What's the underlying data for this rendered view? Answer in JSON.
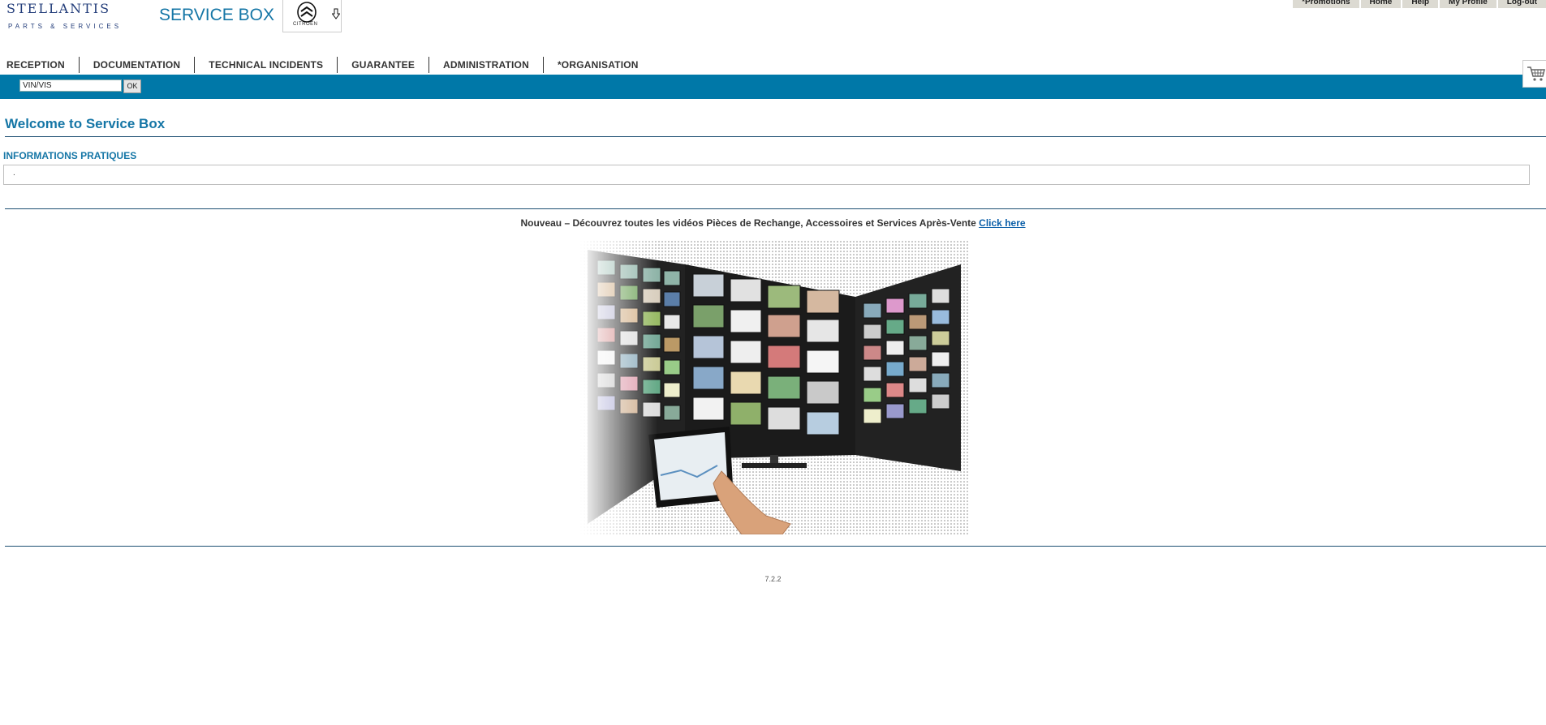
{
  "header": {
    "logo_main": "STELLANTIS",
    "logo_sub": "PARTS & SERVICES",
    "app_title": "SERVICE BOX",
    "brand_name": "CITROËN",
    "brand_color": "#1576a6"
  },
  "top_links": [
    "*Promotions",
    "Home",
    "Help",
    "My Profile",
    "Log-out"
  ],
  "nav": [
    "RECEPTION",
    "DOCUMENTATION",
    "TECHNICAL INCIDENTS",
    "GUARANTEE",
    "ADMINISTRATION",
    "*ORGANISATION"
  ],
  "search": {
    "value": "VIN/VIS",
    "button": "OK",
    "bar_color": "#0078a8"
  },
  "main": {
    "welcome": "Welcome to Service Box",
    "section_label": "INFORMATIONS PRATIQUES",
    "info_text": ".",
    "promo_text": "Nouveau – Découvrez toutes les vidéos Pièces de Rechange, Accessoires et Services Après-Vente",
    "promo_link": "Click here",
    "version": "7.2.2"
  },
  "icons": {
    "cart": "shopping-cart-icon",
    "download": "download-arrow-icon"
  }
}
